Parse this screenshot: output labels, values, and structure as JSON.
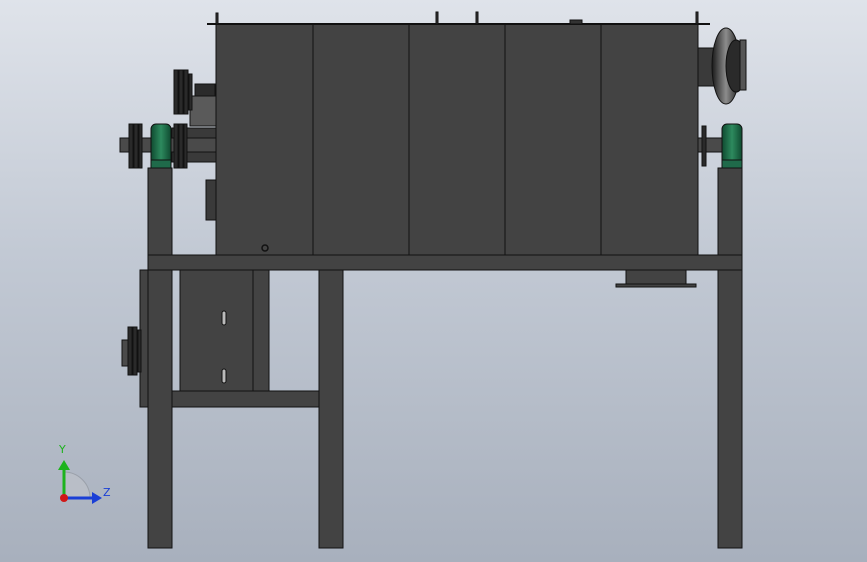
{
  "viewport": {
    "view": "Front view",
    "background_top": "#dfe3ea",
    "background_bottom": "#a8b0bd"
  },
  "model": {
    "body_color": "#434343",
    "edge_color": "#111111",
    "motor_color": "#1f6a4a",
    "tank_panels": 5
  },
  "triad": {
    "y_label": "Y",
    "z_label": "Z",
    "y_color": "#1db31d",
    "z_color": "#1a3fd6",
    "x_color": "#d01818"
  }
}
